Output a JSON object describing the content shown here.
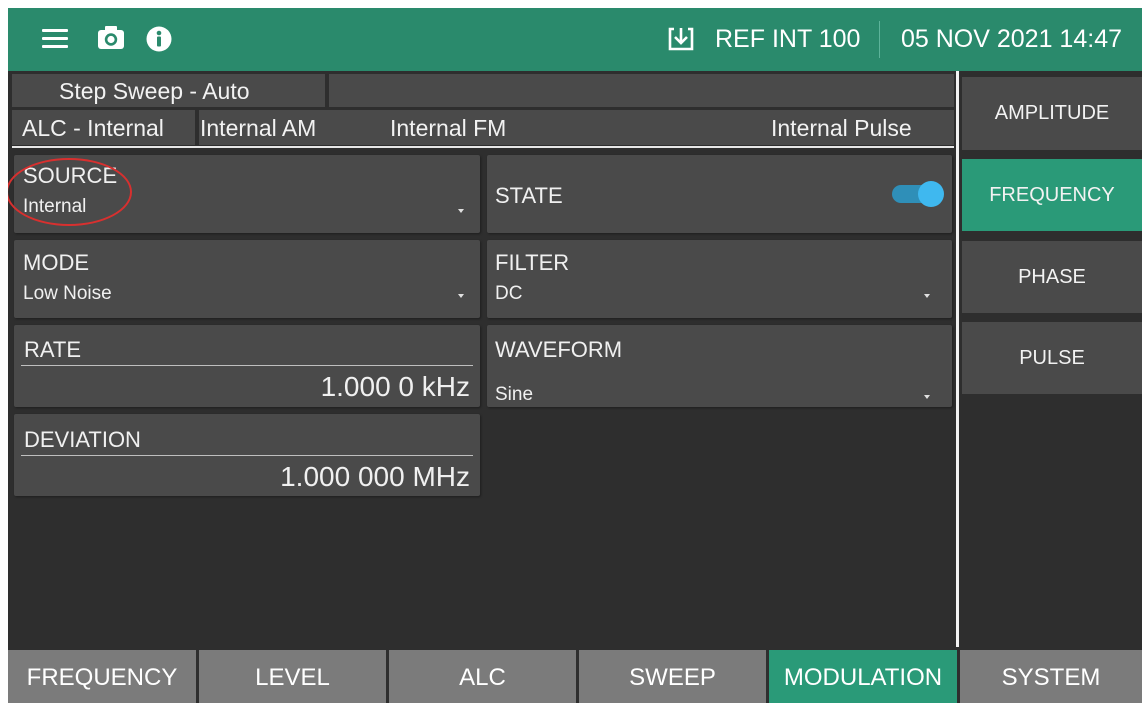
{
  "header": {
    "ref_text": "REF INT 100",
    "datetime": "05 NOV 2021 14:47",
    "icons": [
      "menu-icon",
      "camera-icon",
      "info-icon",
      "reference-download-icon"
    ],
    "bar_color": "#2a8a6c"
  },
  "status": {
    "sweep": "Step Sweep - Auto",
    "alc": "ALC - Internal",
    "am": "Internal AM",
    "fm": "Internal FM",
    "pulse": "Internal Pulse"
  },
  "panels": {
    "source": {
      "label": "SOURCE",
      "value": "Internal"
    },
    "state": {
      "label": "STATE",
      "on": true
    },
    "mode": {
      "label": "MODE",
      "value": "Low Noise"
    },
    "filter": {
      "label": "FILTER",
      "value": "DC"
    },
    "rate": {
      "label": "RATE",
      "value": "1.000  0 kHz"
    },
    "waveform": {
      "label": "WAVEFORM",
      "value": "Sine"
    },
    "deviation": {
      "label": "DEVIATION",
      "value": "1.000  000 MHz"
    }
  },
  "side_menu": [
    {
      "label": "AMPLITUDE",
      "active": false
    },
    {
      "label": "FREQUENCY",
      "active": true
    },
    {
      "label": "PHASE",
      "active": false
    },
    {
      "label": "PULSE",
      "active": false
    }
  ],
  "bottom_tabs": [
    {
      "label": "FREQUENCY",
      "active": false
    },
    {
      "label": "LEVEL",
      "active": false
    },
    {
      "label": "ALC",
      "active": false
    },
    {
      "label": "SWEEP",
      "active": false
    },
    {
      "label": "MODULATION",
      "active": true
    },
    {
      "label": "SYSTEM",
      "active": false
    }
  ],
  "colors": {
    "accent": "#2a9a78",
    "background": "#2e2e2e",
    "panel": "#4a4a4a",
    "tab": "#7b7b7b",
    "toggle": "#3fb8ef",
    "annotation": "#d8302f"
  }
}
